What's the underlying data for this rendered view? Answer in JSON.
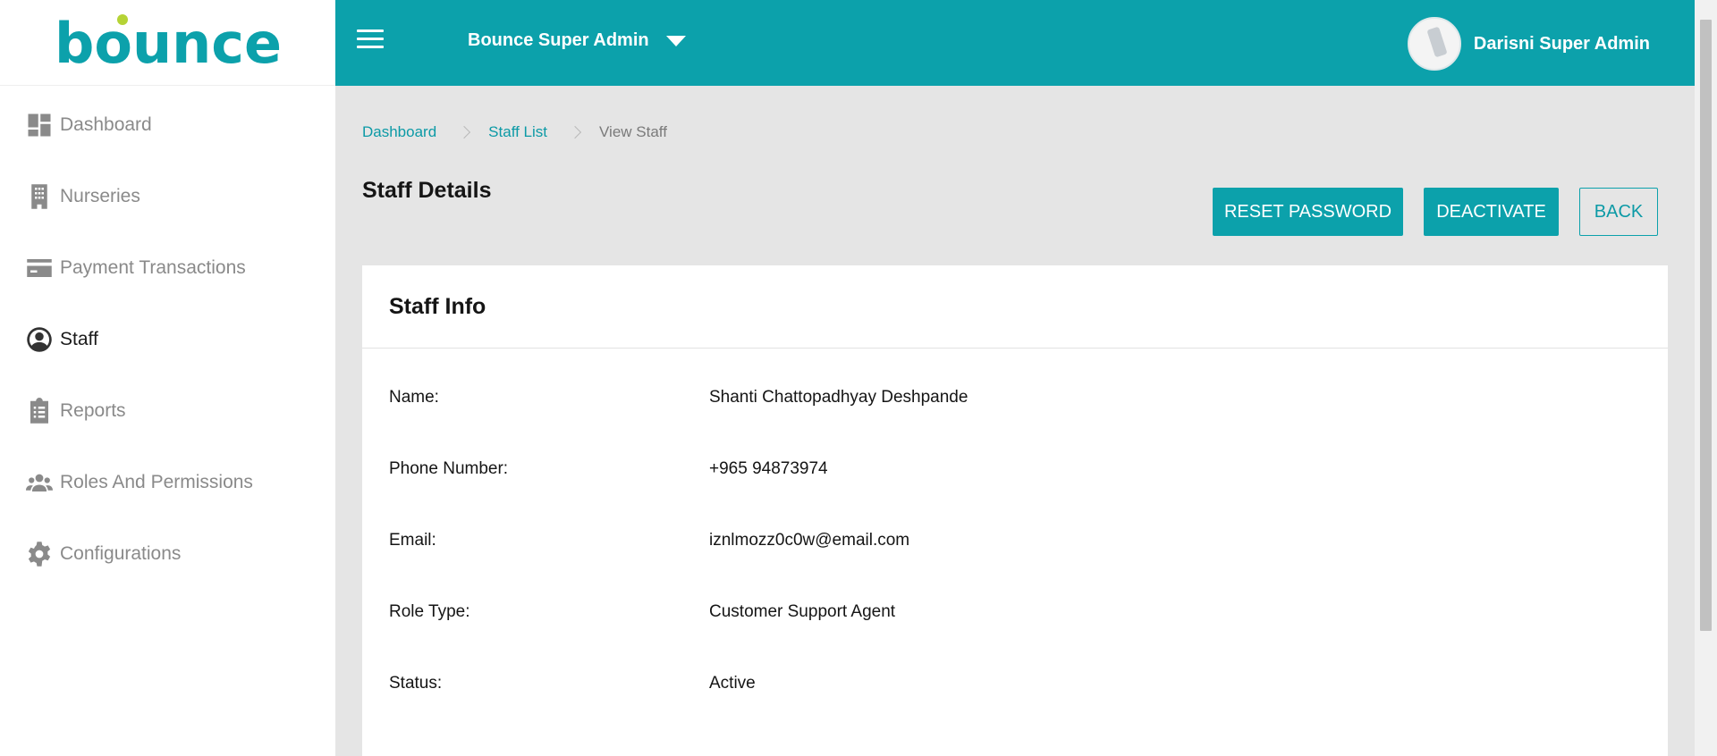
{
  "brand": {
    "logo_text": "bounce",
    "accent": "#0ca1ab",
    "dot": "#b5d335"
  },
  "sidebar": {
    "items": [
      {
        "label": "Dashboard",
        "icon": "dashboard-icon"
      },
      {
        "label": "Nurseries",
        "icon": "building-icon"
      },
      {
        "label": "Payment Transactions",
        "icon": "credit-card-icon"
      },
      {
        "label": "Staff",
        "icon": "user-circle-icon",
        "active": true
      },
      {
        "label": "Reports",
        "icon": "clipboard-icon"
      },
      {
        "label": "Roles And Permissions",
        "icon": "users-group-icon"
      },
      {
        "label": "Configurations",
        "icon": "gear-icon"
      }
    ]
  },
  "header": {
    "org_name": "Bounce Super Admin",
    "user_name": "Darisni Super Admin"
  },
  "breadcrumb": {
    "items": [
      "Dashboard",
      "Staff List"
    ],
    "current": "View Staff"
  },
  "page": {
    "title": "Staff Details",
    "buttons": {
      "reset": "RESET PASSWORD",
      "deactivate": "DEACTIVATE",
      "back": "BACK"
    }
  },
  "card": {
    "title": "Staff Info",
    "rows": [
      {
        "label": "Name:",
        "value": "Shanti Chattopadhyay Deshpande"
      },
      {
        "label": "Phone Number:",
        "value": "+965 94873974"
      },
      {
        "label": "Email:",
        "value": "iznlmozz0c0w@email.com"
      },
      {
        "label": "Role Type:",
        "value": "Customer Support Agent"
      },
      {
        "label": "Status:",
        "value": "Active"
      }
    ]
  }
}
